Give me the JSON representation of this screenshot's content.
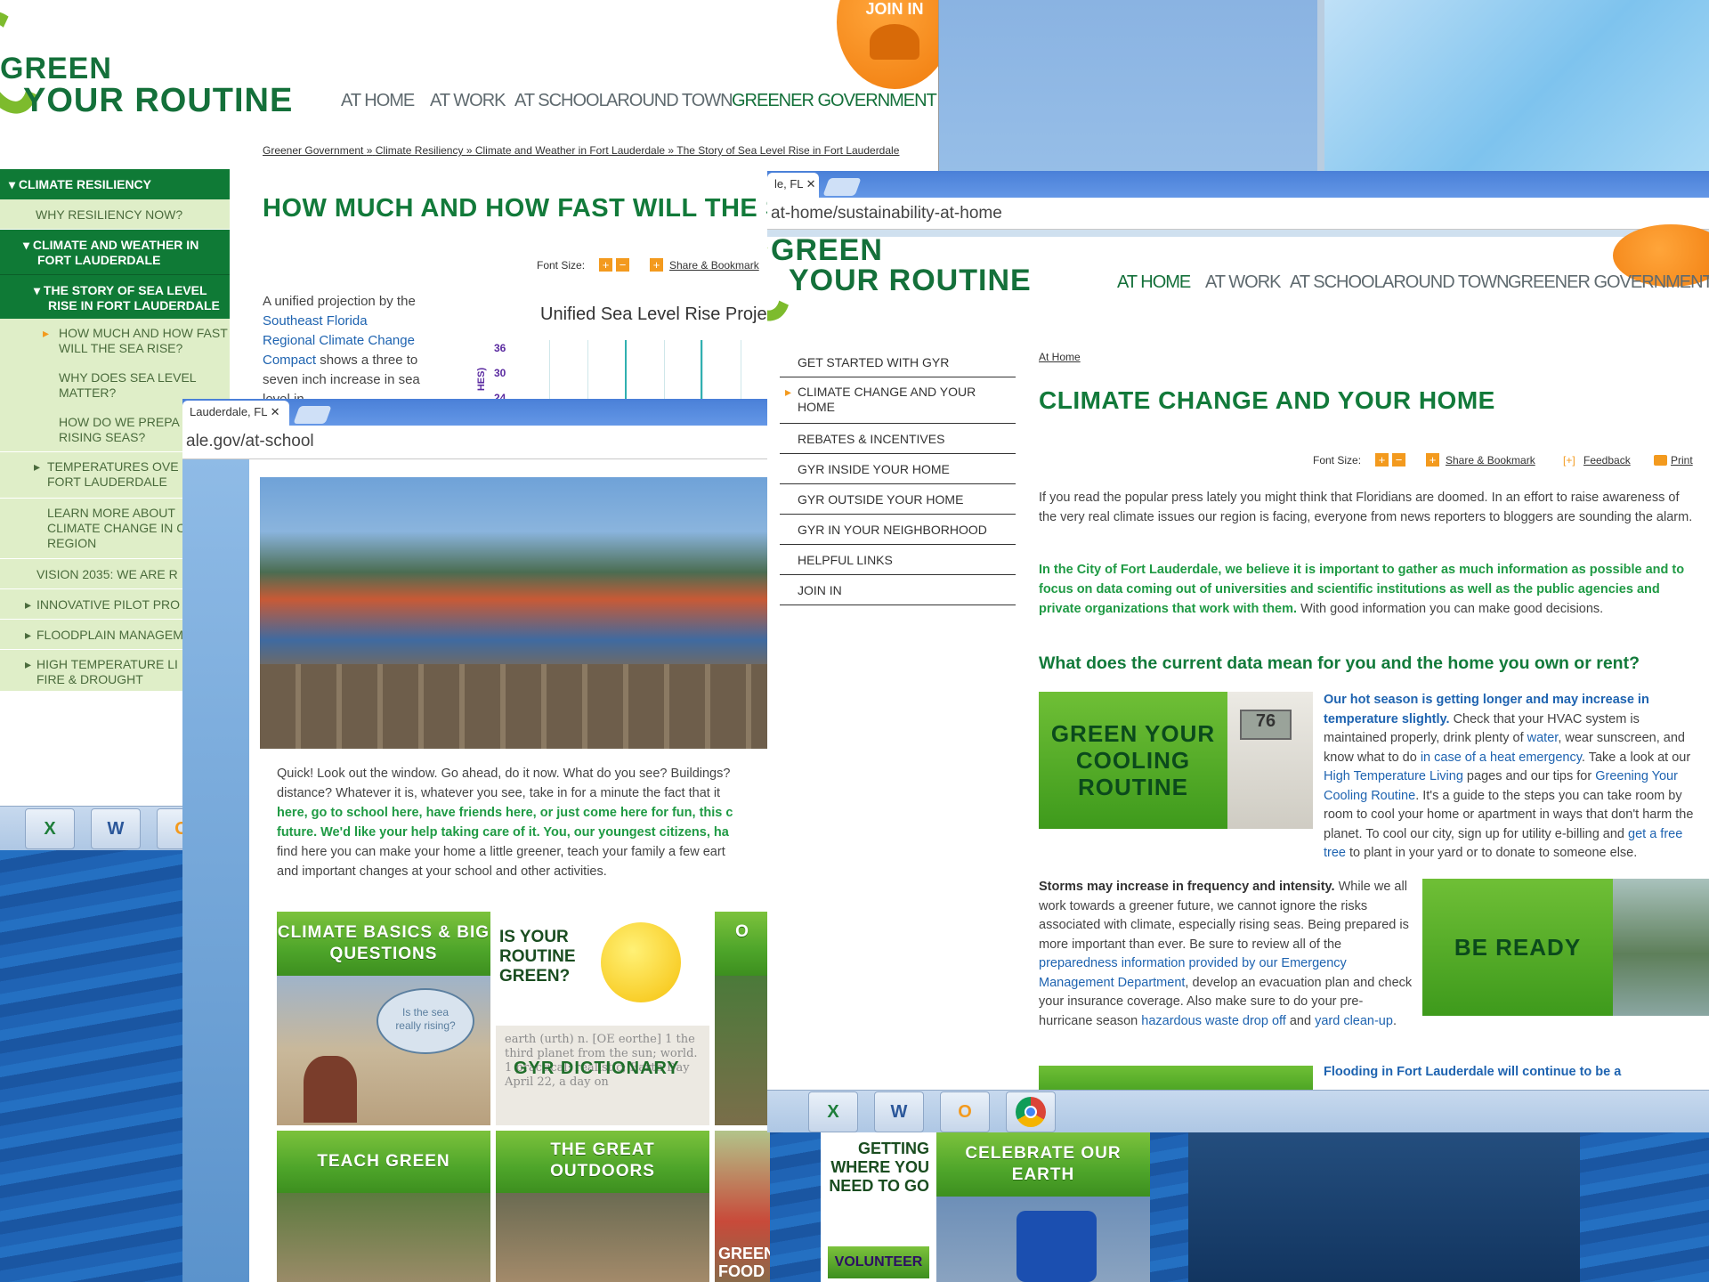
{
  "logo": {
    "line1": "GREEN",
    "line2": "YOUR ROUTINE"
  },
  "nav": [
    "AT HOME",
    "AT WORK",
    "AT SCHOOL",
    "AROUND TOWN",
    "GREENER GOVERNMENT"
  ],
  "join_badge": "JOIN IN",
  "window1": {
    "breadcrumb": [
      "Greener Government",
      "Climate Resiliency",
      "Climate and Weather in Fort Lauderdale",
      "The Story of Sea Level Rise in Fort Lauderdale"
    ],
    "breadcrumb_sep": "»",
    "title": "HOW MUCH AND HOW FAST WILL THE S",
    "font_size_label": "Font Size:",
    "share_label": "Share & Bookmark",
    "sidebar": [
      {
        "label": "CLIMATE RESILIENCY",
        "style": "dark"
      },
      {
        "label": "WHY RESILIENCY NOW?",
        "style": "light"
      },
      {
        "label": "CLIMATE AND WEATHER IN FORT LAUDERDALE",
        "style": "dark"
      },
      {
        "label": "THE STORY OF SEA LEVEL RISE IN FORT LAUDERDALE",
        "style": "dark"
      },
      {
        "label": "HOW MUCH AND HOW FAST WILL THE SEA RISE?",
        "style": "light"
      },
      {
        "label": "WHY DOES SEA LEVEL MATTER?",
        "style": "light"
      },
      {
        "label": "HOW DO WE PREPA FOR RISING SEAS?",
        "style": "light"
      },
      {
        "label": "TEMPERATURES OVE IN FORT LAUDERDALE",
        "style": "light"
      },
      {
        "label": "LEARN MORE ABOUT CLIMATE CHANGE IN C REGION",
        "style": "light"
      },
      {
        "label": "VISION 2035: WE ARE R",
        "style": "light"
      },
      {
        "label": "INNOVATIVE PILOT PRO",
        "style": "light"
      },
      {
        "label": "FLOODPLAIN MANAGEM",
        "style": "light"
      },
      {
        "label": "HIGH TEMPERATURE LI HEAT, FIRE & DROUGHT",
        "style": "light"
      }
    ],
    "body_plain": "A unified projection by the",
    "body_link": "Southeast Florida Regional Climate Change Compact",
    "body_rest": "shows a three to seven inch increase in sea level in",
    "chart_title": "Unified Sea Level Rise Projec",
    "chart_ticks": [
      "36",
      "30",
      "24"
    ],
    "chart_ylabel": "HES)"
  },
  "window2": {
    "tab_label": "Lauderdale, FL",
    "address": "ale.gov/at-school",
    "para_line1": "Quick! Look out the window. Go ahead, do it now. What do you see? Buildings?",
    "para_line2": "distance?  Whatever it is, whatever you see, take in for a minute the fact that it",
    "para_line3_green": "here, go to school here, have friends here, or just come here for fun, this c",
    "para_line4_green": "future. We'd like your help taking care of it. You, our youngest citizens, ha",
    "para_line5": "find here you can make your home a little greener, teach your family a few eart",
    "para_line6": "and important changes at your school and other activities.",
    "tiles": [
      {
        "label": "CLIMATE BASICS & BIG QUESTIONS",
        "bubble": "Is the sea really rising?"
      },
      {
        "label": "IS YOUR ROUTINE GREEN?",
        "sub": "GYR DICTIONARY",
        "dict": "earth (urth) n. [OE eorthe] 1 the third planet from the sun; world. 1 practical; realistic; Earth Day April 22, a day on"
      },
      {
        "label": "O"
      },
      {
        "label": "TEACH GREEN"
      },
      {
        "label": "THE GREAT OUTDOORS"
      },
      {
        "label": "GREEN FOOD"
      },
      {
        "label": "GETTING WHERE YOU NEED TO GO",
        "sub": "VOLUNTEER"
      },
      {
        "label": "CELEBRATE OUR EARTH"
      }
    ]
  },
  "window3": {
    "tab_label": "le, FL",
    "address": "at-home/sustainability-at-home",
    "menu": [
      "GET STARTED WITH GYR",
      "CLIMATE CHANGE AND YOUR HOME",
      "REBATES & INCENTIVES",
      "GYR INSIDE YOUR HOME",
      "GYR OUTSIDE YOUR HOME",
      "GYR IN YOUR NEIGHBORHOOD",
      "HELPFUL LINKS",
      "JOIN IN"
    ],
    "breadcrumb": "At Home",
    "title": "CLIMATE CHANGE AND YOUR HOME",
    "font_size_label": "Font Size:",
    "share_label": "Share & Bookmark",
    "feedback_label": "Feedback",
    "feedback_prefix": "[+]",
    "print_label": "Print",
    "p1": "If you read the popular press lately you might think that Floridians are doomed. In an effort to raise awareness of the very real climate issues our region is facing, everyone from news reporters to bloggers are sounding the alarm.",
    "p2_green": "In the City of Fort Lauderdale, we believe it is important to gather as much information as possible and to focus on data coming out of universities and scientific institutions as well as the public agencies and private organizations that work with them.",
    "p2_rest": " With good information you can make good decisions.",
    "h2": "What does the current data mean for you and the home you own or rent?",
    "tile1": "GREEN YOUR COOLING ROUTINE",
    "thermostat": "76",
    "p3_lead": "Our hot season is getting longer and may increase in temperature slightly.",
    "p3_a": " Check that your HVAC system is maintained properly, drink plenty of ",
    "p3_water": "water",
    "p3_b": ", wear sunscreen, and know what to do ",
    "p3_heat": "in case of a heat emergency",
    "p3_c": ". Take a look at our ",
    "p3_htl": "High Temperature Living",
    "p3_d": " pages and our tips for ",
    "p3_gycr": "Greening Your Cooling Routine",
    "p3_e": ". It's a guide to the steps you can take room by room to cool your home or apartment in ways that don't harm the planet. To cool our city, sign up for utility e-billing and ",
    "p3_tree": "get a free tree",
    "p3_f": " to plant in your yard or to donate to someone else.",
    "p4_lead": "Storms may increase in frequency and intensity.",
    "p4_a": " While we all work towards a greener future, we cannot ignore the risks associated with climate, especially rising seas. Being prepared is more important than ever. Be sure to review all of the ",
    "p4_prep": "preparedness information provided by our Emergency Management Department",
    "p4_b": ", develop an evacuation plan and check your insurance coverage. Also make sure to do your pre-hurricane season ",
    "p4_haz": "hazardous waste drop off",
    "p4_c": " and ",
    "p4_yard": "yard clean-up",
    "p4_d": ".",
    "tile2": "BE READY",
    "p5_lead": "Flooding in Fort Lauderdale will continue to be a"
  },
  "taskbar": {
    "apps": [
      "excel-icon",
      "word-icon",
      "outlook-icon",
      "chrome-icon"
    ],
    "glyphs": [
      "X",
      "W",
      "O",
      ""
    ]
  },
  "colors": {
    "brand_green": "#14703a",
    "accent_orange": "#f07b0c",
    "link_blue": "#1e63b0",
    "chrome_blue": "#4a80d8"
  }
}
